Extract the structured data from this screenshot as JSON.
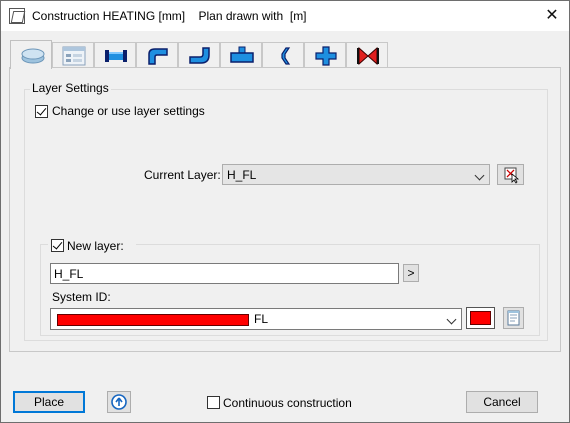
{
  "window": {
    "title": "Construction HEATING [mm]    Plan drawn with  [m]",
    "close_glyph": "✕"
  },
  "tabs": [
    {
      "icon": "layer-icon",
      "active": true
    },
    {
      "icon": "properties-icon"
    },
    {
      "icon": "pipe-straight-icon"
    },
    {
      "icon": "pipe-bend-icon"
    },
    {
      "icon": "pipe-elbow-icon"
    },
    {
      "icon": "tee-icon"
    },
    {
      "icon": "reducer-icon"
    },
    {
      "icon": "cross-icon"
    },
    {
      "icon": "valve-icon"
    }
  ],
  "layer_settings": {
    "group_label": "Layer Settings",
    "change_checkbox_label": "Change or use layer settings",
    "change_checked": true,
    "current_layer_label": "Current Layer:",
    "current_layer_value": "H_FL",
    "new_layer": {
      "checkbox_label": "New layer:",
      "checked": true,
      "name_value": "H_FL",
      "browse_glyph": ">",
      "system_id_label": "System ID:",
      "system_id_value": "FL",
      "system_color": "#ff0000"
    }
  },
  "footer": {
    "place_label": "Place",
    "continuous_label": "Continuous construction",
    "continuous_checked": false,
    "cancel_label": "Cancel"
  }
}
